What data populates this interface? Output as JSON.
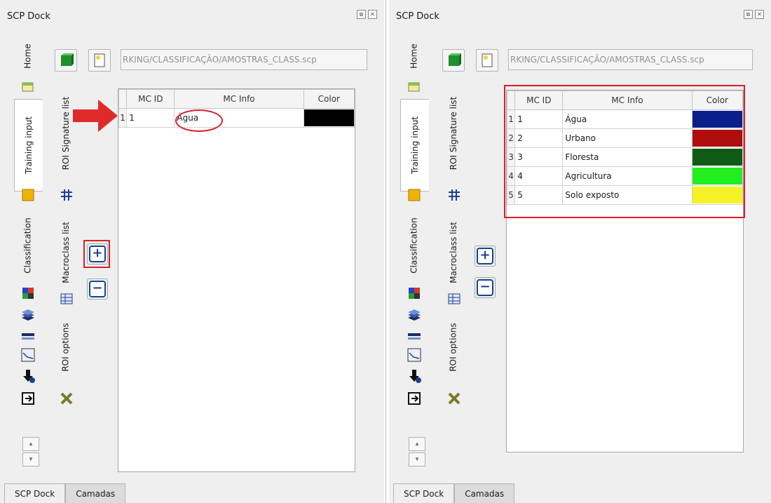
{
  "left": {
    "dock_title": "SCP Dock",
    "dock_title_underline": "D",
    "main_tabs": [
      {
        "label": "Home"
      },
      {
        "label": "Training input"
      },
      {
        "label": "Classification"
      }
    ],
    "sub_tabs": [
      {
        "label": "ROI Signature list"
      },
      {
        "label": "Macroclass list"
      },
      {
        "label": "ROI options"
      }
    ],
    "file_path": "RKING/CLASSIFICAÇÃO/AMOSTRAS_CLASS.scp",
    "table": {
      "columns": [
        "MC ID",
        "MC Info",
        "Color"
      ],
      "rows": [
        {
          "rownum": "1",
          "id": "1",
          "info": "Água",
          "color": "#000000"
        }
      ]
    },
    "bottom_tabs": [
      "SCP Dock",
      "Camadas"
    ]
  },
  "right": {
    "dock_title": "SCP Dock",
    "main_tabs": [
      {
        "label": "Home"
      },
      {
        "label": "Training input"
      },
      {
        "label": "Classification"
      }
    ],
    "sub_tabs": [
      {
        "label": "ROI Signature list"
      },
      {
        "label": "Macroclass list"
      },
      {
        "label": "ROI options"
      }
    ],
    "file_path": "RKING/CLASSIFICAÇÃO/AMOSTRAS_CLASS.scp",
    "table": {
      "columns": [
        "MC ID",
        "MC Info",
        "Color"
      ],
      "rows": [
        {
          "rownum": "1",
          "id": "1",
          "info": "Água",
          "color": "#0a1f8c"
        },
        {
          "rownum": "2",
          "id": "2",
          "info": "Urbano",
          "color": "#b00d0d"
        },
        {
          "rownum": "3",
          "id": "3",
          "info": "Floresta",
          "color": "#0f5a14"
        },
        {
          "rownum": "4",
          "id": "4",
          "info": "Agricultura",
          "color": "#22ee22"
        },
        {
          "rownum": "5",
          "id": "5",
          "info": "Solo exposto",
          "color": "#f2f226"
        }
      ]
    },
    "bottom_tabs": [
      "SCP Dock",
      "Camadas"
    ]
  },
  "colors": {
    "highlight_red": "#d9202b",
    "accent_blue": "#1c3f97"
  },
  "icons": {
    "dock_float": "restore-icon",
    "dock_close": "close-icon",
    "new_file": "green-cube-icon",
    "open_file": "open-file-icon",
    "add": "plus-icon",
    "remove": "minus-icon"
  }
}
